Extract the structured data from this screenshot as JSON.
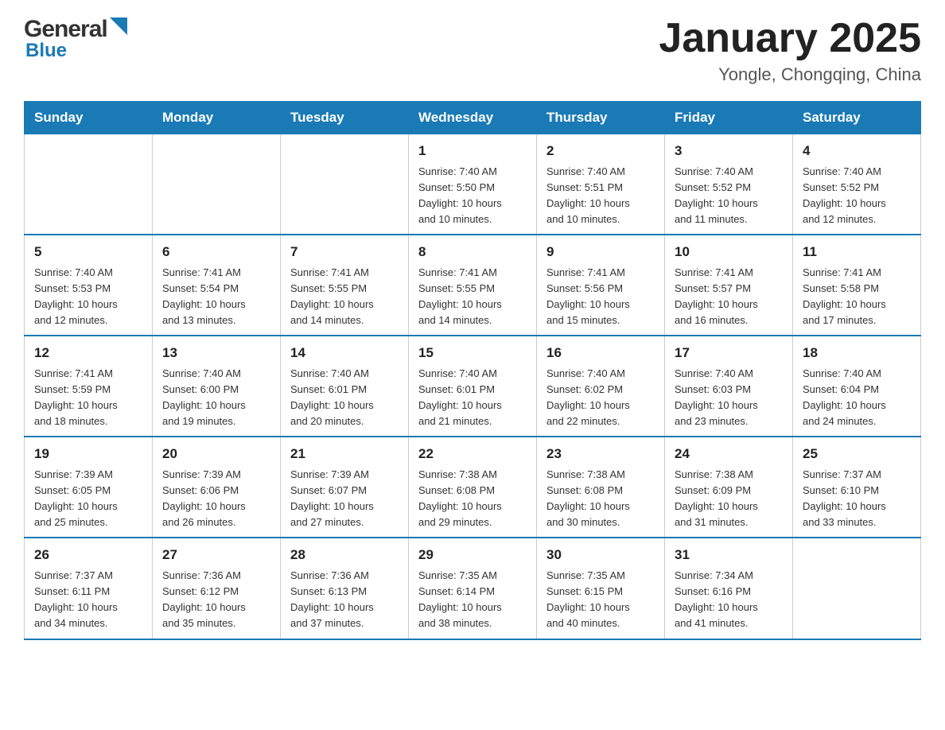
{
  "header": {
    "logo_general": "General",
    "logo_blue": "Blue",
    "title": "January 2025",
    "subtitle": "Yongle, Chongqing, China"
  },
  "days_of_week": [
    "Sunday",
    "Monday",
    "Tuesday",
    "Wednesday",
    "Thursday",
    "Friday",
    "Saturday"
  ],
  "weeks": [
    {
      "days": [
        {
          "number": "",
          "info": ""
        },
        {
          "number": "",
          "info": ""
        },
        {
          "number": "",
          "info": ""
        },
        {
          "number": "1",
          "info": "Sunrise: 7:40 AM\nSunset: 5:50 PM\nDaylight: 10 hours\nand 10 minutes."
        },
        {
          "number": "2",
          "info": "Sunrise: 7:40 AM\nSunset: 5:51 PM\nDaylight: 10 hours\nand 10 minutes."
        },
        {
          "number": "3",
          "info": "Sunrise: 7:40 AM\nSunset: 5:52 PM\nDaylight: 10 hours\nand 11 minutes."
        },
        {
          "number": "4",
          "info": "Sunrise: 7:40 AM\nSunset: 5:52 PM\nDaylight: 10 hours\nand 12 minutes."
        }
      ]
    },
    {
      "days": [
        {
          "number": "5",
          "info": "Sunrise: 7:40 AM\nSunset: 5:53 PM\nDaylight: 10 hours\nand 12 minutes."
        },
        {
          "number": "6",
          "info": "Sunrise: 7:41 AM\nSunset: 5:54 PM\nDaylight: 10 hours\nand 13 minutes."
        },
        {
          "number": "7",
          "info": "Sunrise: 7:41 AM\nSunset: 5:55 PM\nDaylight: 10 hours\nand 14 minutes."
        },
        {
          "number": "8",
          "info": "Sunrise: 7:41 AM\nSunset: 5:55 PM\nDaylight: 10 hours\nand 14 minutes."
        },
        {
          "number": "9",
          "info": "Sunrise: 7:41 AM\nSunset: 5:56 PM\nDaylight: 10 hours\nand 15 minutes."
        },
        {
          "number": "10",
          "info": "Sunrise: 7:41 AM\nSunset: 5:57 PM\nDaylight: 10 hours\nand 16 minutes."
        },
        {
          "number": "11",
          "info": "Sunrise: 7:41 AM\nSunset: 5:58 PM\nDaylight: 10 hours\nand 17 minutes."
        }
      ]
    },
    {
      "days": [
        {
          "number": "12",
          "info": "Sunrise: 7:41 AM\nSunset: 5:59 PM\nDaylight: 10 hours\nand 18 minutes."
        },
        {
          "number": "13",
          "info": "Sunrise: 7:40 AM\nSunset: 6:00 PM\nDaylight: 10 hours\nand 19 minutes."
        },
        {
          "number": "14",
          "info": "Sunrise: 7:40 AM\nSunset: 6:01 PM\nDaylight: 10 hours\nand 20 minutes."
        },
        {
          "number": "15",
          "info": "Sunrise: 7:40 AM\nSunset: 6:01 PM\nDaylight: 10 hours\nand 21 minutes."
        },
        {
          "number": "16",
          "info": "Sunrise: 7:40 AM\nSunset: 6:02 PM\nDaylight: 10 hours\nand 22 minutes."
        },
        {
          "number": "17",
          "info": "Sunrise: 7:40 AM\nSunset: 6:03 PM\nDaylight: 10 hours\nand 23 minutes."
        },
        {
          "number": "18",
          "info": "Sunrise: 7:40 AM\nSunset: 6:04 PM\nDaylight: 10 hours\nand 24 minutes."
        }
      ]
    },
    {
      "days": [
        {
          "number": "19",
          "info": "Sunrise: 7:39 AM\nSunset: 6:05 PM\nDaylight: 10 hours\nand 25 minutes."
        },
        {
          "number": "20",
          "info": "Sunrise: 7:39 AM\nSunset: 6:06 PM\nDaylight: 10 hours\nand 26 minutes."
        },
        {
          "number": "21",
          "info": "Sunrise: 7:39 AM\nSunset: 6:07 PM\nDaylight: 10 hours\nand 27 minutes."
        },
        {
          "number": "22",
          "info": "Sunrise: 7:38 AM\nSunset: 6:08 PM\nDaylight: 10 hours\nand 29 minutes."
        },
        {
          "number": "23",
          "info": "Sunrise: 7:38 AM\nSunset: 6:08 PM\nDaylight: 10 hours\nand 30 minutes."
        },
        {
          "number": "24",
          "info": "Sunrise: 7:38 AM\nSunset: 6:09 PM\nDaylight: 10 hours\nand 31 minutes."
        },
        {
          "number": "25",
          "info": "Sunrise: 7:37 AM\nSunset: 6:10 PM\nDaylight: 10 hours\nand 33 minutes."
        }
      ]
    },
    {
      "days": [
        {
          "number": "26",
          "info": "Sunrise: 7:37 AM\nSunset: 6:11 PM\nDaylight: 10 hours\nand 34 minutes."
        },
        {
          "number": "27",
          "info": "Sunrise: 7:36 AM\nSunset: 6:12 PM\nDaylight: 10 hours\nand 35 minutes."
        },
        {
          "number": "28",
          "info": "Sunrise: 7:36 AM\nSunset: 6:13 PM\nDaylight: 10 hours\nand 37 minutes."
        },
        {
          "number": "29",
          "info": "Sunrise: 7:35 AM\nSunset: 6:14 PM\nDaylight: 10 hours\nand 38 minutes."
        },
        {
          "number": "30",
          "info": "Sunrise: 7:35 AM\nSunset: 6:15 PM\nDaylight: 10 hours\nand 40 minutes."
        },
        {
          "number": "31",
          "info": "Sunrise: 7:34 AM\nSunset: 6:16 PM\nDaylight: 10 hours\nand 41 minutes."
        },
        {
          "number": "",
          "info": ""
        }
      ]
    }
  ]
}
